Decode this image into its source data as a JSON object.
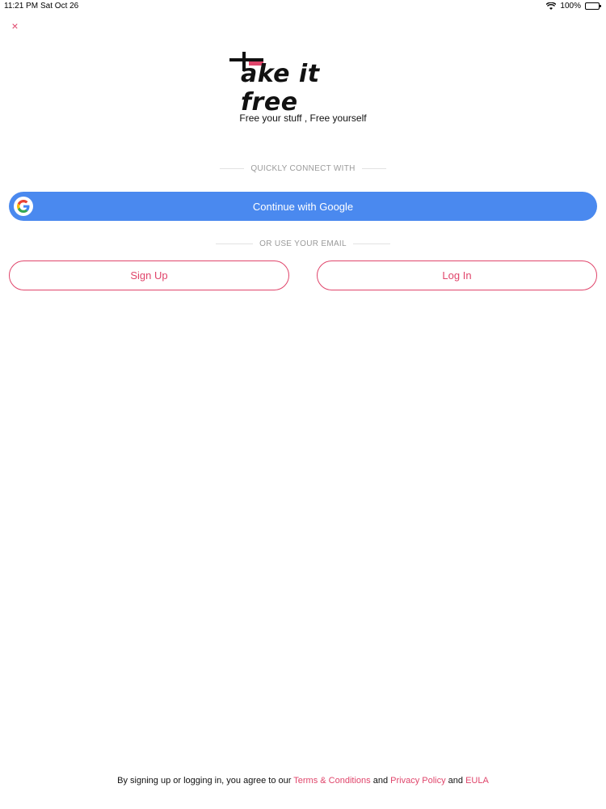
{
  "status_bar": {
    "time": "11:21 PM",
    "date": "Sat Oct 26",
    "battery": "100%",
    "battery_level": 1.0
  },
  "close": {
    "icon": "close-icon",
    "glyph": "×"
  },
  "logo": {
    "text": "ake it free",
    "brand_color": "#e0456b"
  },
  "tagline": "Free your stuff , Free yourself",
  "connect_divider": "QUICKLY CONNECT WITH",
  "google_button": {
    "label": "Continue with Google",
    "icon": "google-icon",
    "color": "#4a89ef"
  },
  "email_divider": "OR USE YOUR EMAIL",
  "signup_button": "Sign Up",
  "login_button": "Log In",
  "footer": {
    "prefix": "By signing up or logging in, you agree to our",
    "terms": "Terms & Conditions",
    "and1": "and",
    "privacy": "Privacy Policy",
    "and2": "and",
    "eula": "EULA"
  }
}
